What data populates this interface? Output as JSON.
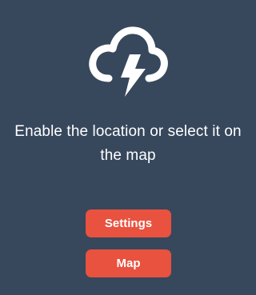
{
  "location_prompt": {
    "icon": "cloud-lightning-icon",
    "message": "Enable the location or select it on the map",
    "settings_label": "Settings",
    "map_label": "Map"
  },
  "colors": {
    "background": "#37475c",
    "button": "#e8523f",
    "text": "#ffffff"
  }
}
